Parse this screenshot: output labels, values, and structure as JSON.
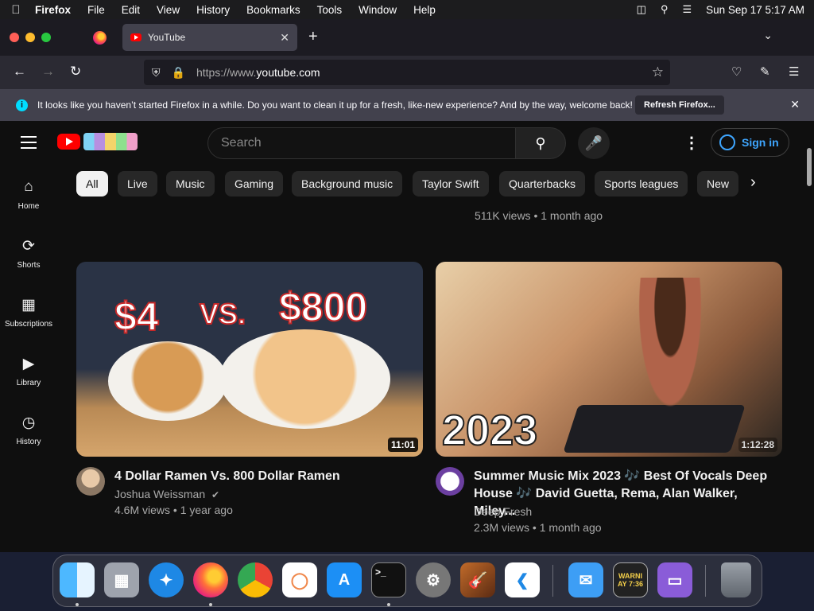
{
  "menubar": {
    "app": "Firefox",
    "items": [
      "File",
      "Edit",
      "View",
      "History",
      "Bookmarks",
      "Tools",
      "Window",
      "Help"
    ],
    "datetime": "Sun Sep 17  5:17 AM"
  },
  "browser": {
    "tab_title": "YouTube",
    "url_prefix": "https://www.",
    "url_host": "youtube.com",
    "notification_text": "It looks like you haven’t started Firefox in a while. Do you want to clean it up for a fresh, like-new experience? And by the way, welcome back!",
    "notification_button": "Refresh Firefox..."
  },
  "youtube": {
    "search_placeholder": "Search",
    "signin_label": "Sign in",
    "sidebar": [
      "Home",
      "Shorts",
      "Subscriptions",
      "Library",
      "History"
    ],
    "chips": [
      "All",
      "Live",
      "Music",
      "Gaming",
      "Background music",
      "Taylor Swift",
      "Quarterbacks",
      "Sports leagues",
      "New"
    ],
    "previous_meta": "511K views • 1 month ago",
    "videos": [
      {
        "title": "4 Dollar Ramen Vs. 800 Dollar Ramen",
        "channel": "Joshua Weissman",
        "meta": "4.6M views • 1 year ago",
        "duration": "11:01",
        "thumb_text_left": "$4",
        "thumb_text_mid": "VS.",
        "thumb_text_right": "$800"
      },
      {
        "title": "Summer Music Mix 2023 🎶 Best Of Vocals Deep House 🎶 David Guetta, Rema, Alan Walker, Miley...",
        "channel": "Deep Fresh",
        "meta": "2.3M views • 1 month ago",
        "duration": "1:12:28",
        "thumb_text": "2023"
      }
    ]
  },
  "dock": {
    "apps": [
      "Finder",
      "Launchpad",
      "Safari",
      "Firefox",
      "Chrome",
      "Pieces",
      "App Store",
      "Terminal",
      "System Settings",
      "GarageBand",
      "VS Code",
      "Mail",
      "Console",
      "Simulator",
      "Trash"
    ],
    "console_text": "WARNI\nAY 7:36"
  }
}
